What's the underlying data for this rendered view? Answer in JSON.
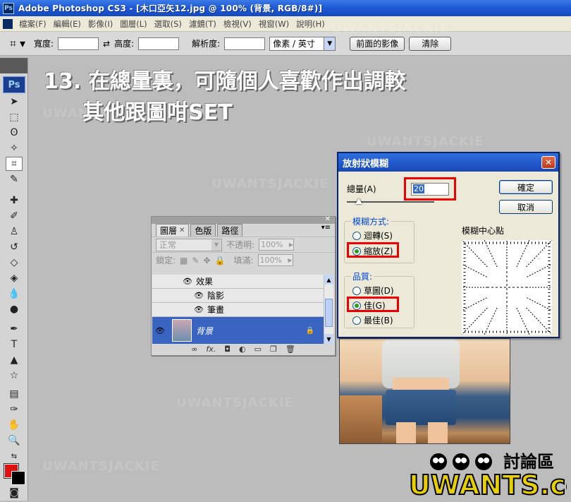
{
  "window": {
    "title": "Adobe Photoshop CS3 - [木口亞矢12.jpg @ 100% (背景, RGB/8#)]",
    "app_icon": "Ps"
  },
  "menu": [
    "檔案(F)",
    "編輯(E)",
    "影像(I)",
    "圖層(L)",
    "選取(S)",
    "濾鏡(T)",
    "檢視(V)",
    "視窗(W)",
    "說明(H)"
  ],
  "options": {
    "width_label": "寬度:",
    "height_label": "高度:",
    "resolution_label": "解析度:",
    "unit_value": "像素 / 英寸",
    "front_image_button": "前面的影像",
    "clear_button": "清除"
  },
  "toolbox": {
    "ps_label": "Ps"
  },
  "caption": {
    "line1": "13. 在總量裏，可隨個人喜歡作出調較",
    "line2": "其他跟圖咁SET"
  },
  "layers_panel": {
    "tabs": [
      "圖層",
      "色版",
      "路徑"
    ],
    "blend_mode": "正常",
    "opacity_label": "不透明:",
    "opacity_value": "100%",
    "lock_label": "鎖定:",
    "fill_label": "填滿:",
    "fill_value": "100%",
    "items": [
      {
        "label": "效果"
      },
      {
        "label": "陰影"
      },
      {
        "label": "筆畫"
      }
    ],
    "background_layer": "背景",
    "footer_fx": "fx."
  },
  "dialog": {
    "title": "放射狀模糊",
    "amount_label": "總量(A)",
    "amount_value": "20",
    "ok_button": "確定",
    "cancel_button": "取消",
    "method_label": "模糊方式:",
    "method_options": [
      "迴轉(S)",
      "縮放(Z)"
    ],
    "method_selected": "縮放(Z)",
    "quality_label": "品質:",
    "quality_options": [
      "草圖(D)",
      "佳(G)",
      "最佳(B)"
    ],
    "quality_selected": "佳(G)",
    "center_label": "模糊中心點"
  },
  "watermark": "UWANTSJACKIE",
  "logo": {
    "text": "UWANTS.com",
    "tag": "討論區"
  },
  "colors": {
    "foreground": "#e01010",
    "background": "#000000",
    "highlight": "#e00000",
    "layer_selected": "#3a64c2"
  }
}
